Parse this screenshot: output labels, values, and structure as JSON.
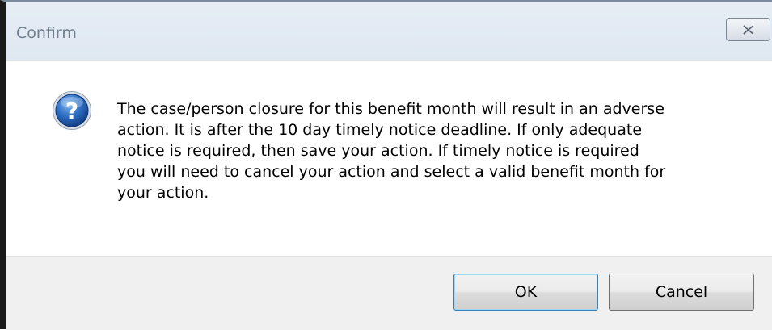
{
  "window": {
    "title": "Confirm"
  },
  "icons": {
    "close": "close-icon",
    "question": "question-icon"
  },
  "message": {
    "text": "The case/person closure for this benefit month will result in an adverse\naction.  It is after the 10 day timely notice deadline.  If only adequate\nnotice is required, then save your action.  If timely notice is required\nyou will need to cancel your action and select a valid benefit month for\nyour action."
  },
  "buttons": {
    "ok_label": "OK",
    "cancel_label": "Cancel"
  },
  "colors": {
    "title_text": "#6f7f8e",
    "icon_blue": "#1f5fb3",
    "focus_border": "#3c7fb1"
  }
}
